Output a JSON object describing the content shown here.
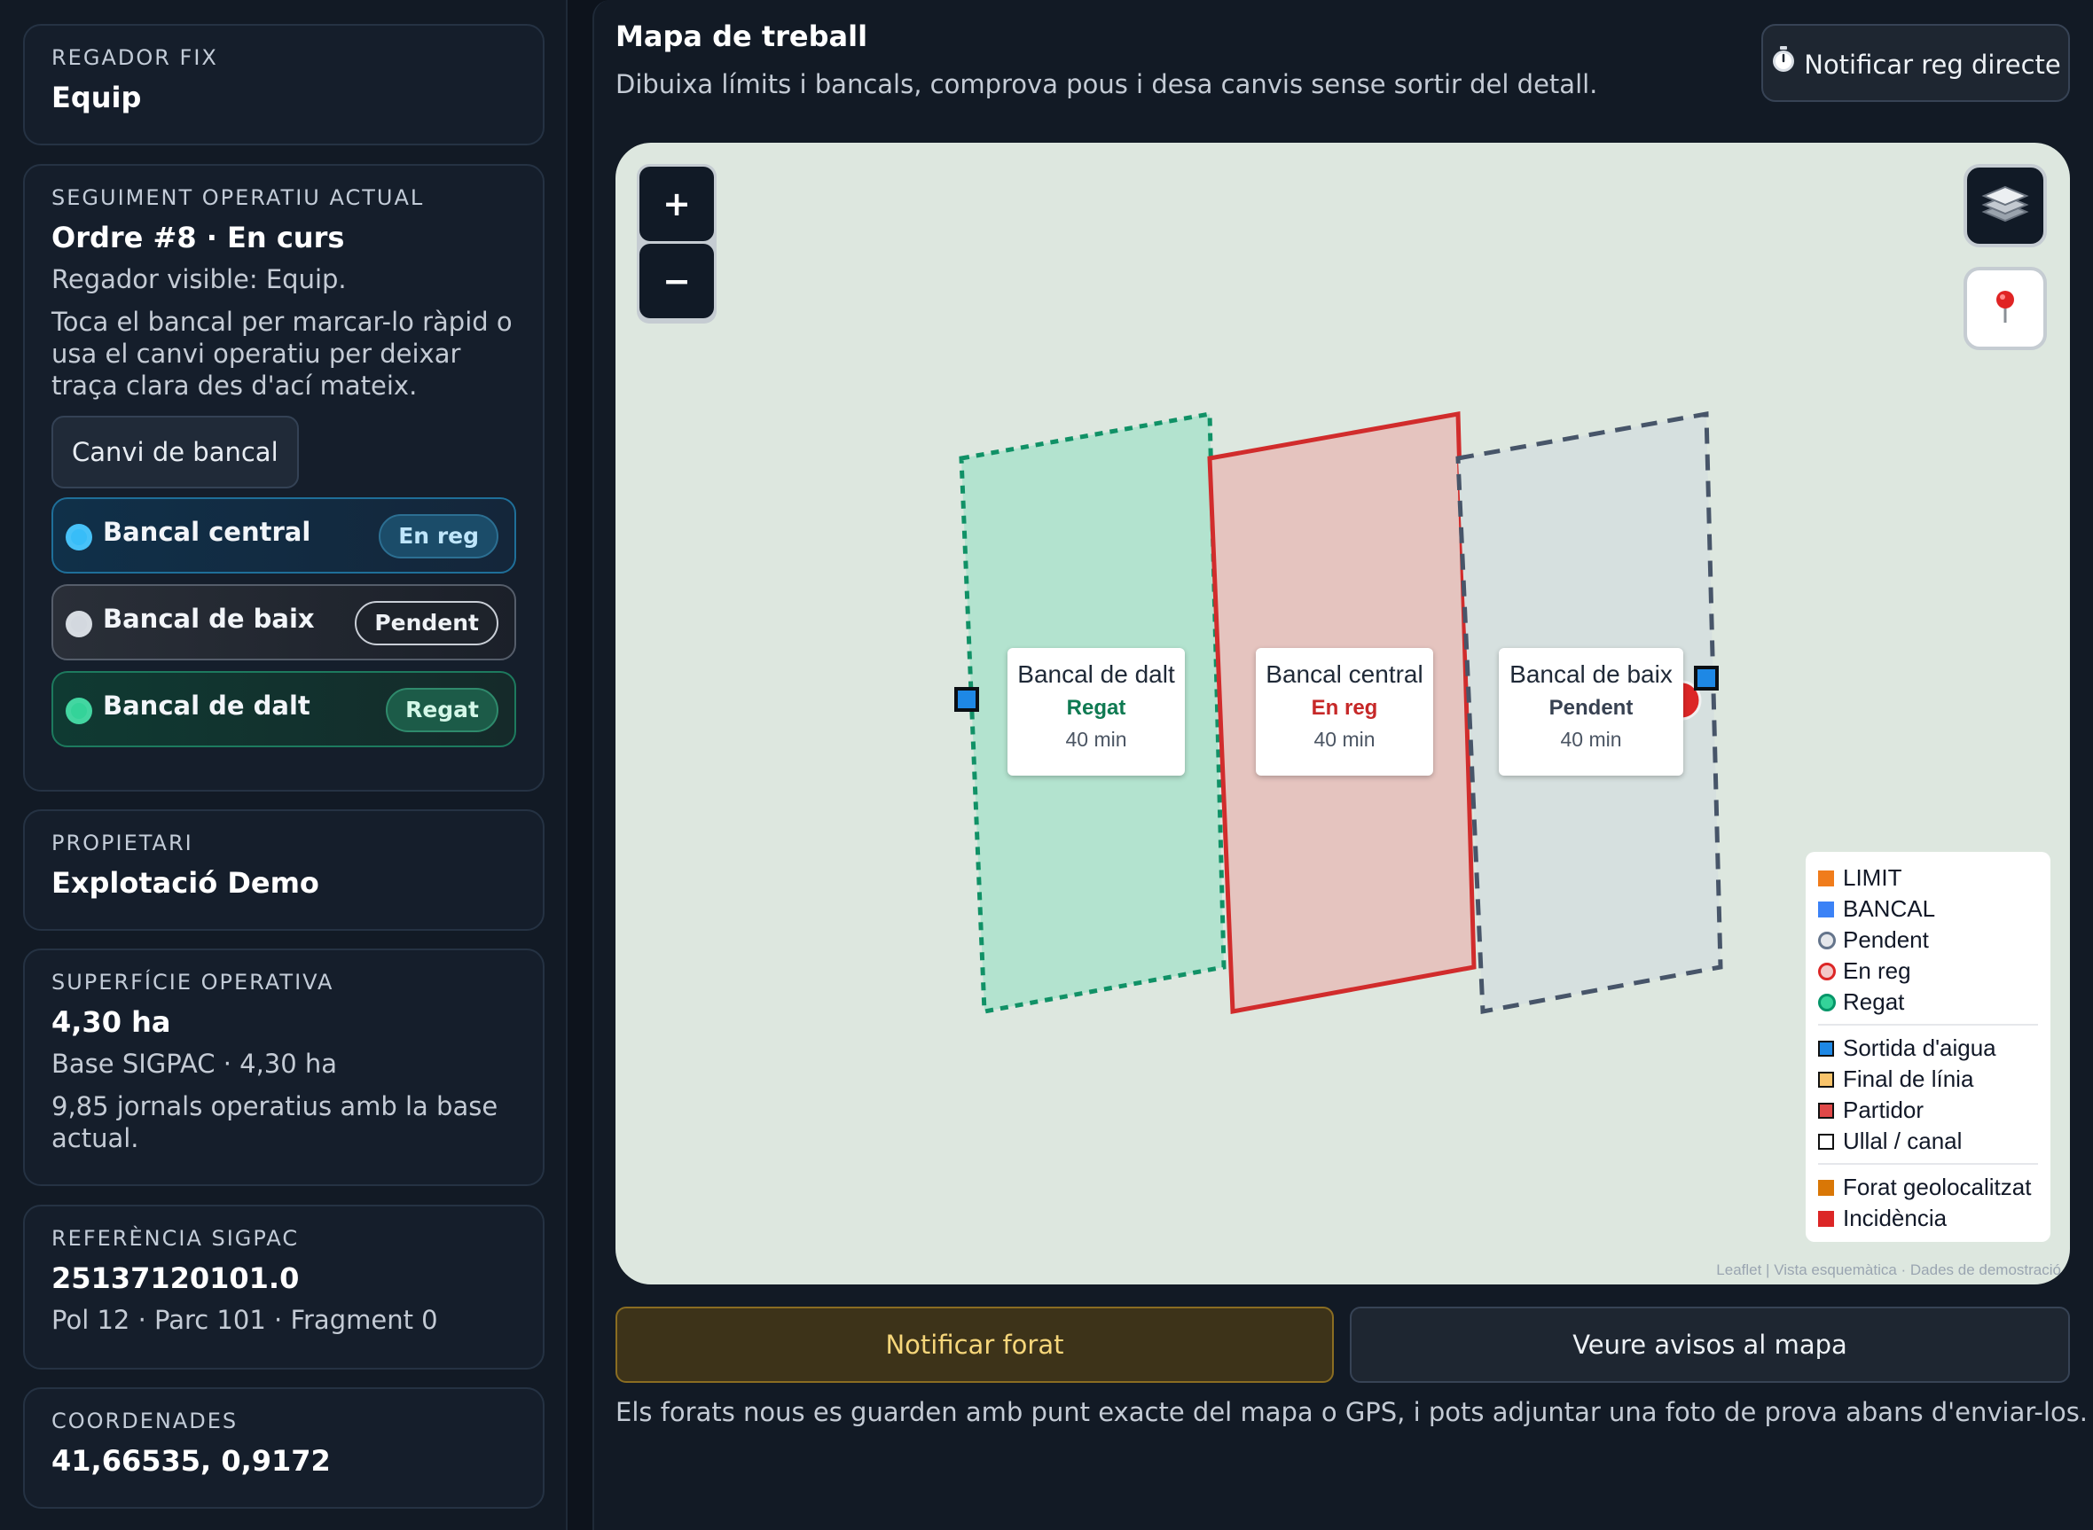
{
  "sidebar": {
    "regador": {
      "label": "REGADOR FIX",
      "value": "Equip"
    },
    "seguiment": {
      "label": "SEGUIMENT OPERATIU ACTUAL",
      "title": "Ordre #8 · En curs",
      "visible": "Regador visible: Equip.",
      "hint": "Toca el bancal per marcar-lo ràpid o usa el canvi operatiu per deixar traça clara des d'ací mateix.",
      "change_button": "Canvi de bancal",
      "bancals": [
        {
          "name": "Bancal central",
          "status": "En reg",
          "color": "#38bdf8"
        },
        {
          "name": "Bancal de baix",
          "status": "Pendent",
          "color": "#d3d8df"
        },
        {
          "name": "Bancal de dalt",
          "status": "Regat",
          "color": "#34d399"
        }
      ]
    },
    "propietari": {
      "label": "PROPIETARI",
      "value": "Explotació Demo"
    },
    "superficie": {
      "label": "SUPERFÍCIE OPERATIVA",
      "value": "4,30 ha",
      "base": "Base SIGPAC · 4,30 ha",
      "jornals": "9,85 jornals operatius amb la base actual."
    },
    "sigpac": {
      "label": "REFERÈNCIA SIGPAC",
      "value": "25137120101.0",
      "detail": "Pol 12 · Parc 101 · Fragment 0"
    },
    "coordenades": {
      "label": "COORDENADES",
      "value": "41,66535, 0,9172"
    }
  },
  "main": {
    "title": "Mapa de treball",
    "subtitle": "Dibuixa límits i bancals, comprova pous i desa canvis sense sortir del detall.",
    "notify_live_button": "Notificar reg directe",
    "notify_live_icon": "stopwatch-icon",
    "map": {
      "zoom_in": "+",
      "zoom_out": "−",
      "layers_icon": "layers-icon",
      "locate_icon": "map-pin-icon",
      "plots": [
        {
          "name": "Bancal de dalt",
          "status": "Regat",
          "time": "40 min",
          "status_color": "#0f7a52",
          "fill": "#b3e3cf",
          "stroke": "#109166"
        },
        {
          "name": "Bancal central",
          "status": "En reg",
          "time": "40 min",
          "status_color": "#c62828",
          "fill": "#e5c4bf",
          "stroke": "#d12c2c"
        },
        {
          "name": "Bancal de baix",
          "status": "Pendent",
          "time": "40 min",
          "status_color": "#374151",
          "fill": "#d6e0df",
          "stroke": "#475569"
        }
      ],
      "legend": {
        "groups": [
          [
            {
              "label": "LIMIT",
              "kind": "square",
              "color": "#f07c1b"
            },
            {
              "label": "BANCAL",
              "kind": "square",
              "color": "#3b82f6"
            },
            {
              "label": "Pendent",
              "kind": "circle",
              "color": "#64748b"
            },
            {
              "label": "En reg",
              "kind": "circle",
              "color": "#dc2626"
            },
            {
              "label": "Regat",
              "kind": "circle",
              "color": "#059669"
            }
          ],
          [
            {
              "label": "Sortida d'aigua",
              "kind": "square-outline",
              "color": "#1e88e5"
            },
            {
              "label": "Final de línia",
              "kind": "square-outline",
              "color": "#f9c46b"
            },
            {
              "label": "Partidor",
              "kind": "square-outline",
              "color": "#e04848"
            },
            {
              "label": "Ullal / canal",
              "kind": "square-outline",
              "color": "#ffffff"
            }
          ],
          [
            {
              "label": "Forat geolocalitzat",
              "kind": "square",
              "color": "#d97706"
            },
            {
              "label": "Incidència",
              "kind": "square",
              "color": "#dc2626"
            }
          ]
        ]
      },
      "attribution": "Leaflet | Vista esquemàtica · Dades de demostració"
    },
    "notify_hole_button": "Notificar forat",
    "view_alerts_button": "Veure avisos al mapa",
    "note": "Els forats nous es guarden amb punt exacte del mapa o GPS, i pots adjuntar una foto de prova abans d'enviar-los."
  }
}
